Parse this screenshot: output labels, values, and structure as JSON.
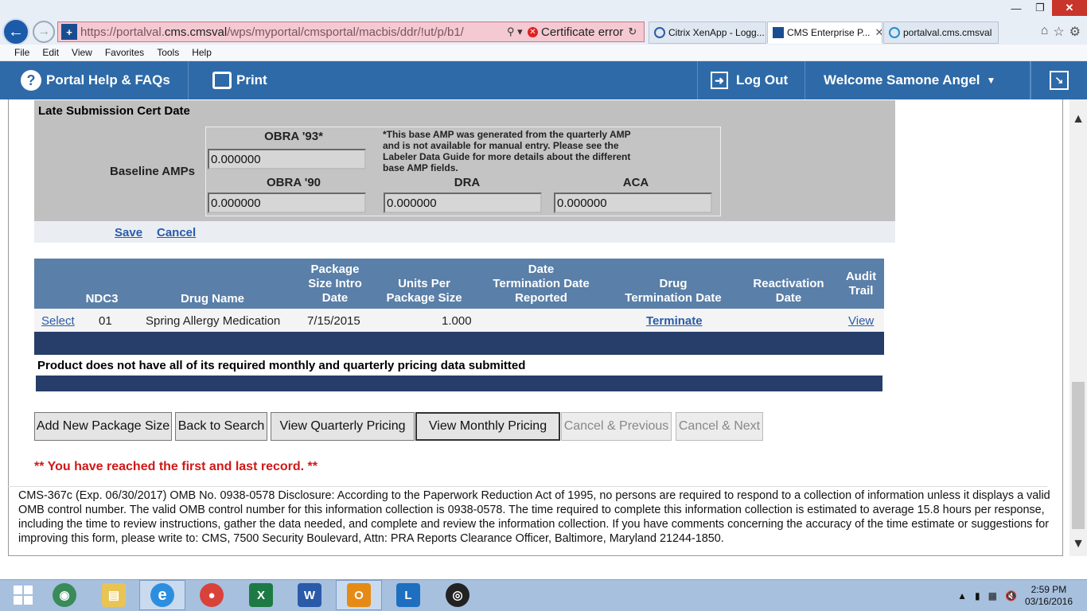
{
  "browser": {
    "url_prefix": "https://portalval.",
    "url_domain": "cms.cmsval",
    "url_path": "/wps/myportal/cmsportal/macbis/ddr/!ut/p/b1/",
    "cert_error": "Certificate error",
    "tabs": [
      {
        "label": "Citrix XenApp - Logg..."
      },
      {
        "label": "CMS Enterprise P..."
      },
      {
        "label": "portalval.cms.cmsval"
      }
    ],
    "menu": [
      "File",
      "Edit",
      "View",
      "Favorites",
      "Tools",
      "Help"
    ]
  },
  "portal_header": {
    "help_label": "Portal Help & FAQs",
    "print_label": "Print",
    "logout_label": "Log Out",
    "welcome_label": "Welcome Samone Angel"
  },
  "amp_form": {
    "late_cert_label": "Late Submission Cert Date",
    "baseline_label": "Baseline AMPs",
    "obra93_header": "OBRA '93*",
    "obra93_value": "0.000000",
    "note": "*This base AMP was generated from the quarterly AMP and is not available for manual entry. Please see the Labeler Data Guide for more details about the different base AMP fields.",
    "obra90_header": "OBRA '90",
    "obra90_value": "0.000000",
    "dra_header": "DRA",
    "dra_value": "0.000000",
    "aca_header": "ACA",
    "aca_value": "0.000000",
    "save_label": "Save",
    "cancel_label": "Cancel"
  },
  "package_table": {
    "headers": {
      "ndc3": "NDC3",
      "drug_name": "Drug Name",
      "pkg_intro_1": "Package",
      "pkg_intro_2": "Size Intro",
      "pkg_intro_3": "Date",
      "units_1": "Units Per",
      "units_2": "Package Size",
      "term_rep_1": "Date",
      "term_rep_2": "Termination Date",
      "term_rep_3": "Reported",
      "drug_term_1": "Drug",
      "drug_term_2": "Termination Date",
      "react_1": "Reactivation",
      "react_2": "Date",
      "audit_1": "Audit",
      "audit_2": "Trail"
    },
    "rows": [
      {
        "select": "Select",
        "ndc3": "01",
        "drug_name": "Spring Allergy Medication",
        "intro_date": "7/15/2015",
        "units": "1.000",
        "term_reported": "",
        "terminate": "Terminate",
        "reactivation": "",
        "audit": "View"
      }
    ],
    "warning": "Product does not have all of its required monthly and quarterly pricing data submitted"
  },
  "buttons": {
    "add_new": "Add New Package Size",
    "back": "Back to Search",
    "view_quarterly": "View Quarterly Pricing",
    "view_monthly": "View Monthly Pricing",
    "cancel_previous": "Cancel & Previous",
    "cancel_next": "Cancel & Next"
  },
  "record_message": "** You have reached the first and last record. **",
  "disclosure": "CMS-367c (Exp. 06/30/2017) OMB No. 0938-0578 Disclosure: According to the Paperwork Reduction Act of 1995, no persons are required to respond to a collection of information unless it displays a valid OMB control number. The valid OMB control number for this information collection is 0938-0578. The time required to complete this information collection is estimated to average 15.8 hours per response, including the time to review instructions, gather the data needed, and complete and review the information collection. If you have comments concerning the accuracy of the time estimate or suggestions for improving this form, please write to: CMS, 7500 Security Boulevard, Attn: PRA Reports Clearance Officer, Baltimore, Maryland 21244-1850.",
  "taskbar": {
    "time": "2:59 PM",
    "date": "03/16/2016"
  },
  "colors": {
    "portal_blue": "#2e6aa8",
    "table_header": "#5a7fa8",
    "dark_band": "#263e69",
    "record_red": "#d01818"
  }
}
